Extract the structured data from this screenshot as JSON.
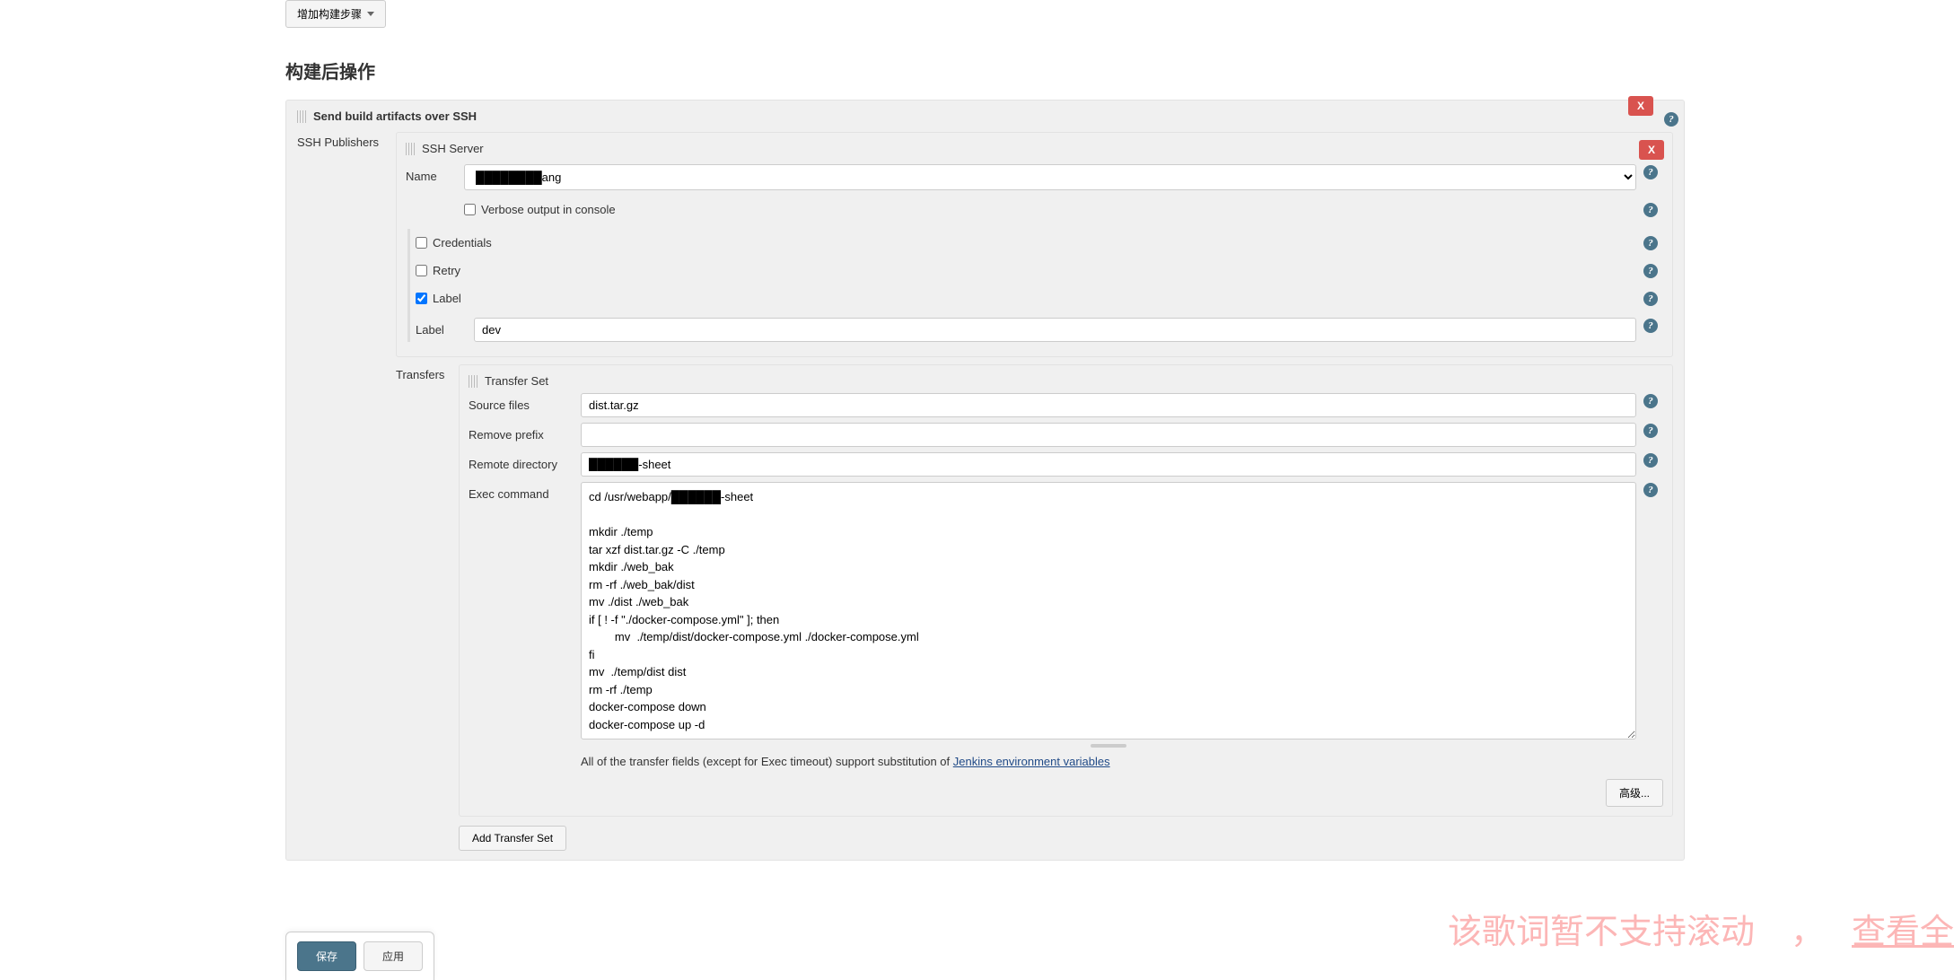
{
  "addBuildStep": "增加构建步骤",
  "sectionTitle": "构建后操作",
  "mainBlock": {
    "title": "Send build artifacts over SSH",
    "closeLabel": "X",
    "sshPublishersLabel": "SSH Publishers",
    "sshServer": {
      "title": "SSH Server",
      "closeLabel": "X",
      "nameLabel": "Name",
      "nameValue": "████████ang",
      "verboseLabel": "Verbose output in console",
      "credentialsLabel": "Credentials",
      "retryLabel": "Retry",
      "labelCheckLabel": "Label",
      "labelFieldLabel": "Label",
      "labelValue": "dev"
    },
    "transfers": {
      "sideLabel": "Transfers",
      "title": "Transfer Set",
      "sourceFilesLabel": "Source files",
      "sourceFilesValue": "dist.tar.gz",
      "removePrefixLabel": "Remove prefix",
      "removePrefixValue": "",
      "remoteDirLabel": "Remote directory",
      "remoteDirValue": "██████-sheet",
      "execCmdLabel": "Exec command",
      "execCmdValue": "cd /usr/webapp/██████-sheet\n\nmkdir ./temp\ntar xzf dist.tar.gz -C ./temp\nmkdir ./web_bak\nrm -rf ./web_bak/dist\nmv ./dist ./web_bak\nif [ ! -f \"./docker-compose.yml\" ]; then\n        mv  ./temp/dist/docker-compose.yml ./docker-compose.yml\nfi\nmv  ./temp/dist dist\nrm -rf ./temp\ndocker-compose down\ndocker-compose up -d",
      "noteText": "All of the transfer fields (except for Exec timeout) support substitution of ",
      "noteLink": "Jenkins environment variables",
      "advancedBtn": "高级...",
      "addTransferSetBtn": "Add Transfer Set"
    }
  },
  "footer": {
    "save": "保存",
    "apply": "应用"
  },
  "overlay": {
    "text1": "该歌词暂不支持滚动",
    "comma": "，",
    "text2": "查看全"
  }
}
